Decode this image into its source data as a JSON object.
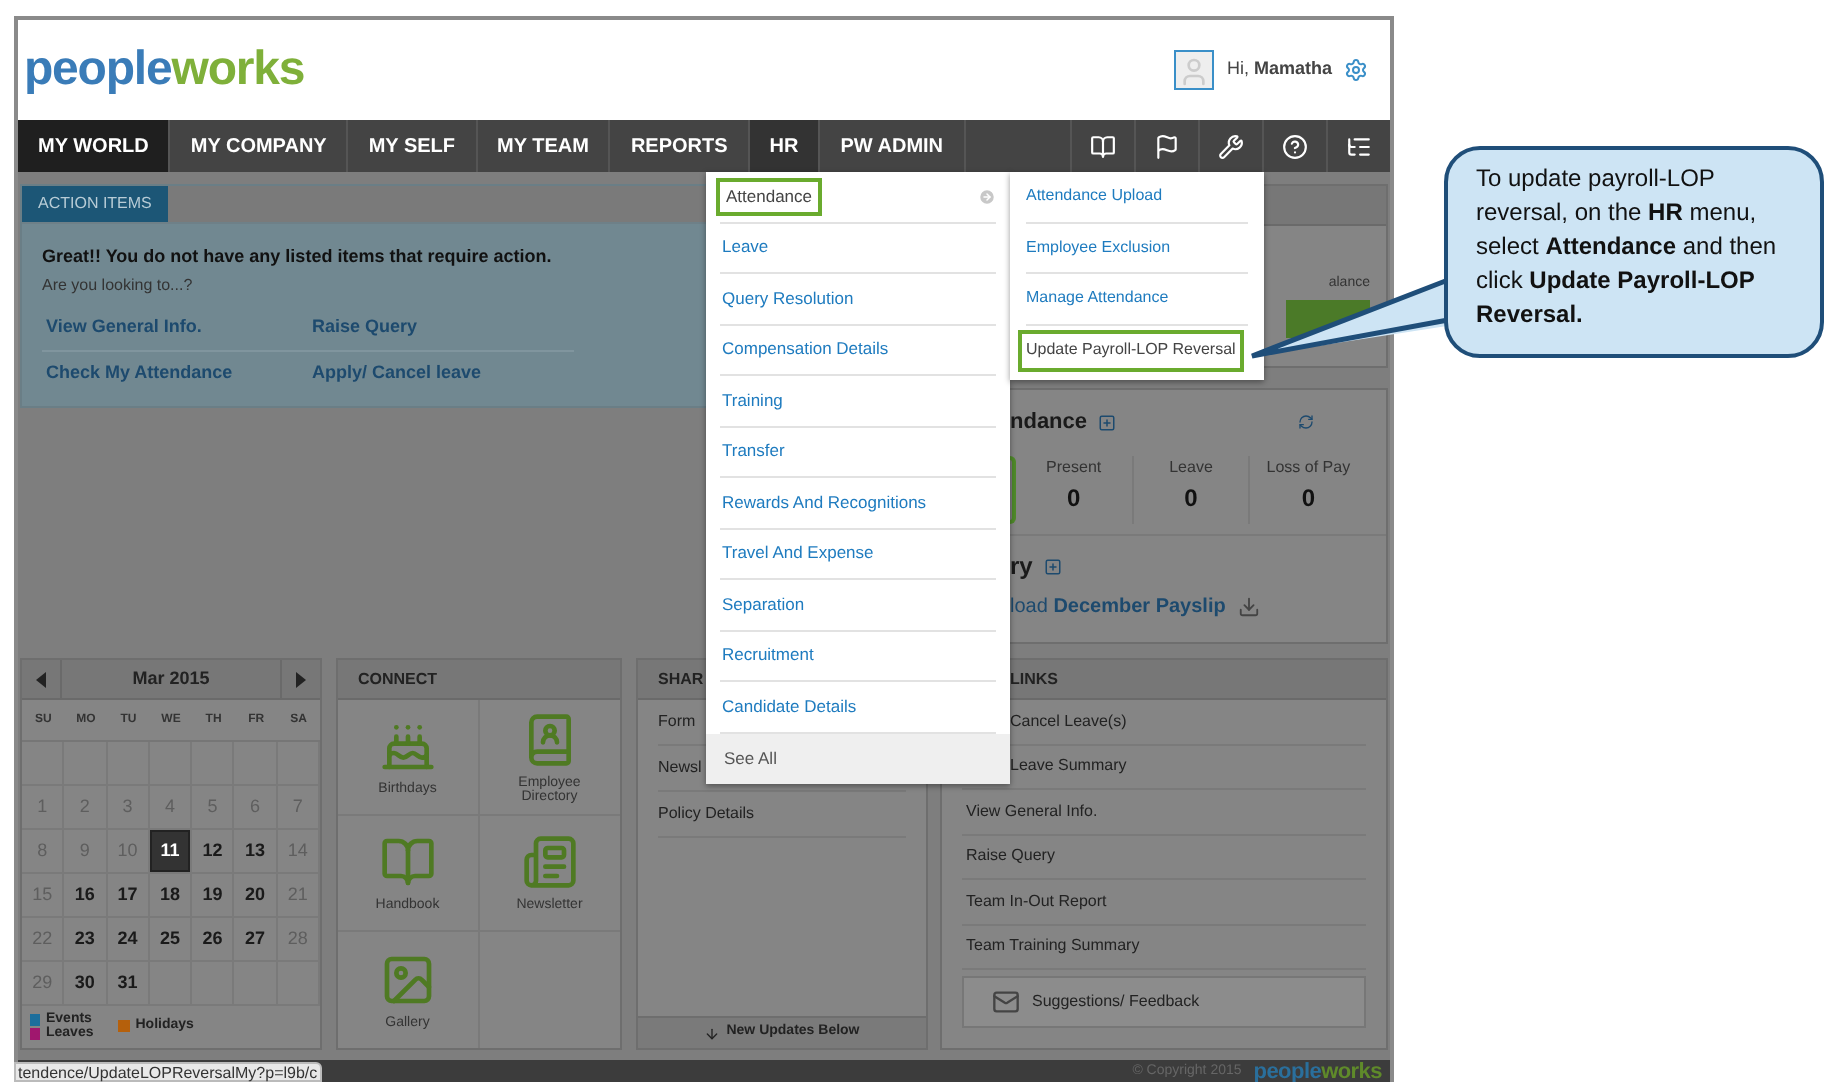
{
  "header": {
    "logo": [
      "people",
      "works"
    ],
    "greeting": "Hi, **Mamatha**"
  },
  "nav": {
    "tabs": [
      {
        "label": "MY WORLD",
        "selected": true,
        "expanded": false
      },
      {
        "label": "MY COMPANY",
        "selected": false,
        "expanded": false
      },
      {
        "label": "MY SELF",
        "selected": false,
        "expanded": false
      },
      {
        "label": "MY TEAM",
        "selected": false,
        "expanded": false
      },
      {
        "label": "REPORTS",
        "selected": false,
        "expanded": false
      },
      {
        "label": "HR",
        "selected": false,
        "expanded": true
      },
      {
        "label": "PW ADMIN",
        "selected": false,
        "expanded": false
      }
    ]
  },
  "hr_menu": {
    "items": [
      {
        "label": "Attendance",
        "kind": "link",
        "selected": true,
        "has_submenu": true
      },
      {
        "label": "Leave",
        "kind": "link",
        "selected": false,
        "has_submenu": false
      },
      {
        "label": "Query Resolution",
        "kind": "link",
        "selected": false,
        "has_submenu": false
      },
      {
        "label": "Compensation Details",
        "kind": "link",
        "selected": false,
        "has_submenu": false
      },
      {
        "label": "Training",
        "kind": "link",
        "selected": false,
        "has_submenu": false
      },
      {
        "label": "Transfer",
        "kind": "link",
        "selected": false,
        "has_submenu": false
      },
      {
        "label": "Rewards And Recognitions",
        "kind": "link",
        "selected": false,
        "has_submenu": false
      },
      {
        "label": "Travel And Expense",
        "kind": "link",
        "selected": false,
        "has_submenu": false
      },
      {
        "label": "Separation",
        "kind": "link",
        "selected": false,
        "has_submenu": false
      },
      {
        "label": "Recruitment",
        "kind": "link",
        "selected": false,
        "has_submenu": false
      },
      {
        "label": "Candidate Details",
        "kind": "link",
        "selected": false,
        "has_submenu": false
      },
      {
        "label": "See All",
        "kind": "footer",
        "selected": false,
        "has_submenu": false
      }
    ],
    "submenu": [
      {
        "label": "Attendance Upload",
        "selected": false
      },
      {
        "label": "Employee Exclusion",
        "selected": false
      },
      {
        "label": "Manage Attendance",
        "selected": false
      },
      {
        "label": "Update Payroll-LOP Reversal",
        "selected": true
      }
    ]
  },
  "action_items": {
    "tab": "ACTION ITEMS",
    "message": "Great!! You do not have any listed items that require action.",
    "prompt": "Are you looking to...?",
    "links": [
      "View General Info.",
      "Raise Query",
      "Check My Attendance",
      "Apply/ Cancel leave"
    ]
  },
  "balance_panel": {
    "label": "alance"
  },
  "attendance": {
    "title": "ndance",
    "stats": [
      {
        "label": "Present",
        "value": "0"
      },
      {
        "label": "Leave",
        "value": "0"
      },
      {
        "label": "Loss of Pay",
        "value": "0"
      }
    ]
  },
  "payroll": {
    "title": "ry",
    "link": "load **December Payslip**"
  },
  "calendar": {
    "month": "Mar 2015",
    "weekdays": [
      "SU",
      "MO",
      "TU",
      "WE",
      "TH",
      "FR",
      "SA"
    ],
    "weeks": [
      [
        {
          "day": "1",
          "muted": true,
          "selected": false
        },
        {
          "day": "2",
          "muted": true,
          "selected": false
        },
        {
          "day": "3",
          "muted": true,
          "selected": false
        },
        {
          "day": "4",
          "muted": true,
          "selected": false
        },
        {
          "day": "5",
          "muted": true,
          "selected": false
        },
        {
          "day": "6",
          "muted": true,
          "selected": false
        },
        {
          "day": "7",
          "muted": true,
          "selected": false
        }
      ],
      [
        {
          "day": "8",
          "muted": true,
          "selected": false
        },
        {
          "day": "9",
          "muted": true,
          "selected": false
        },
        {
          "day": "10",
          "muted": true,
          "selected": false
        },
        {
          "day": "11",
          "muted": false,
          "selected": true
        },
        {
          "day": "12",
          "muted": false,
          "selected": false
        },
        {
          "day": "13",
          "muted": false,
          "selected": false
        },
        {
          "day": "14",
          "muted": true,
          "selected": false
        }
      ],
      [
        {
          "day": "15",
          "muted": true,
          "selected": false
        },
        {
          "day": "16",
          "muted": false,
          "selected": false
        },
        {
          "day": "17",
          "muted": false,
          "selected": false
        },
        {
          "day": "18",
          "muted": false,
          "selected": false
        },
        {
          "day": "19",
          "muted": false,
          "selected": false
        },
        {
          "day": "20",
          "muted": false,
          "selected": false
        },
        {
          "day": "21",
          "muted": true,
          "selected": false
        }
      ],
      [
        {
          "day": "22",
          "muted": true,
          "selected": false
        },
        {
          "day": "23",
          "muted": false,
          "selected": false
        },
        {
          "day": "24",
          "muted": false,
          "selected": false
        },
        {
          "day": "25",
          "muted": false,
          "selected": false
        },
        {
          "day": "26",
          "muted": false,
          "selected": false
        },
        {
          "day": "27",
          "muted": false,
          "selected": false
        },
        {
          "day": "28",
          "muted": true,
          "selected": false
        }
      ],
      [
        {
          "day": "29",
          "muted": true,
          "selected": false
        },
        {
          "day": "30",
          "muted": false,
          "selected": false
        },
        {
          "day": "31",
          "muted": false,
          "selected": false
        }
      ]
    ],
    "legend": [
      {
        "label": "Events",
        "color": "#1c6e9c"
      },
      {
        "label": "Leaves",
        "color": "#a0176e"
      },
      {
        "label": "Holidays",
        "color": "#b5600c"
      }
    ]
  },
  "connect": {
    "title": "CONNECT",
    "tiles": [
      {
        "label": "Birthdays",
        "kind": "cake"
      },
      {
        "label": "Employee Directory",
        "kind": "directory"
      },
      {
        "label": "Handbook",
        "kind": "book"
      },
      {
        "label": "Newsletter",
        "kind": "newspaper"
      },
      {
        "label": "Gallery",
        "kind": "gallery"
      }
    ]
  },
  "share": {
    "title": "SHAR",
    "items": [
      "Form",
      "Newsl",
      "Policy Details"
    ],
    "footer": "New Updates Below"
  },
  "quick_links": {
    "title": "LINKS",
    "items": [
      "Cancel Leave(s)",
      "Leave Summary",
      "View General Info.",
      "Raise Query",
      "Team In-Out Report",
      "Team Training Summary"
    ],
    "feedback": "Suggestions/ Feedback"
  },
  "footer": {
    "copyright": "© Copyright 2015",
    "logo": [
      "people",
      "works"
    ]
  },
  "status_bar": {
    "url": "tendence/UpdateLOPReversalMy?p=l9b/c"
  },
  "callout": {
    "text": "To update payroll-LOP reversal, on the **HR** menu, select **Attendance**  and then click **Update Payroll-LOP Reversal.**"
  }
}
